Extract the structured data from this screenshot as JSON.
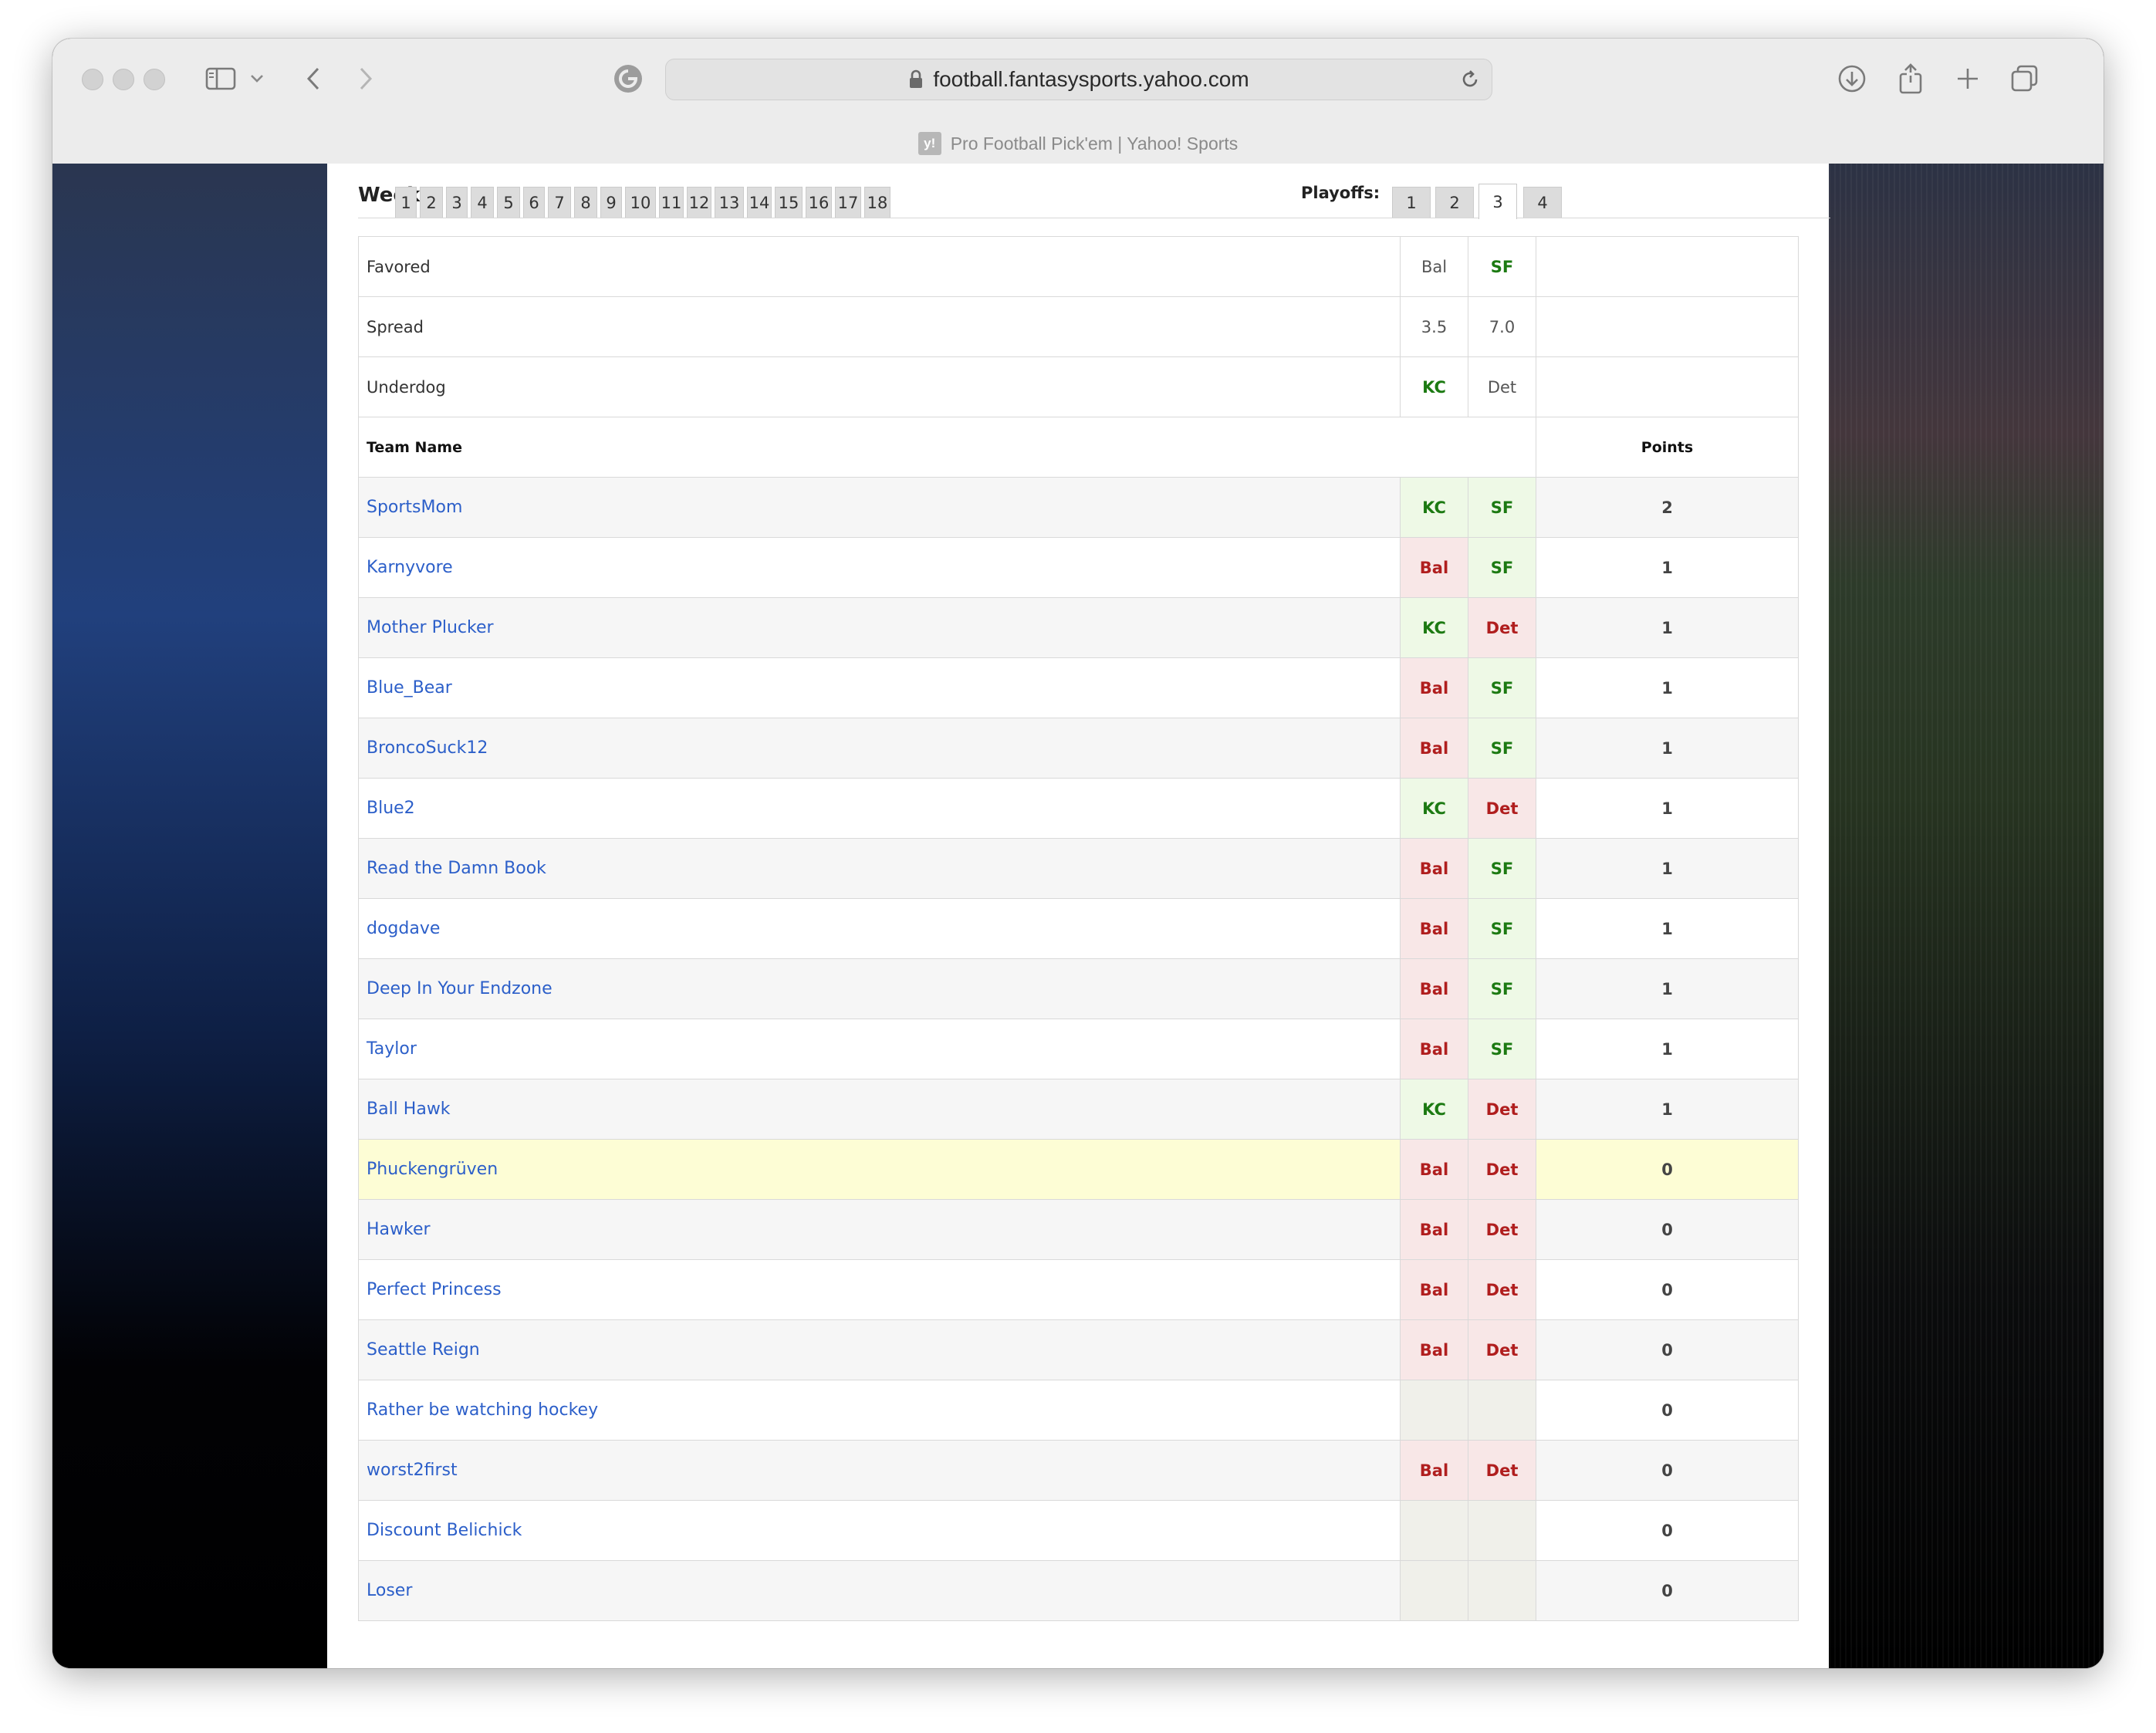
{
  "browser": {
    "url": "football.fantasysports.yahoo.com",
    "tab_title": "Pro Football Pick'em | Yahoo! Sports",
    "favicon_text": "y!"
  },
  "weeks": {
    "label": "Week",
    "items": [
      "1",
      "2",
      "3",
      "4",
      "5",
      "6",
      "7",
      "8",
      "9",
      "10",
      "11",
      "12",
      "13",
      "14",
      "15",
      "16",
      "17",
      "18"
    ],
    "playoffs_label": "Playoffs:",
    "playoffs": [
      "1",
      "2",
      "3",
      "4"
    ],
    "active_playoff": "3"
  },
  "games": {
    "favored_label": "Favored",
    "spread_label": "Spread",
    "underdog_label": "Underdog",
    "game1": {
      "favored": "Bal",
      "spread": "3.5",
      "underdog": "KC",
      "winner": "KC"
    },
    "game2": {
      "favored": "SF",
      "spread": "7.0",
      "underdog": "Det",
      "winner": "SF"
    }
  },
  "table_header": {
    "team_name": "Team Name",
    "points": "Points"
  },
  "teams": [
    {
      "name": "SportsMom",
      "p1": "KC",
      "p2": "SF",
      "points": "2"
    },
    {
      "name": "Karnyvore",
      "p1": "Bal",
      "p2": "SF",
      "points": "1"
    },
    {
      "name": "Mother Plucker",
      "p1": "KC",
      "p2": "Det",
      "points": "1"
    },
    {
      "name": "Blue_Bear",
      "p1": "Bal",
      "p2": "SF",
      "points": "1"
    },
    {
      "name": "BroncoSuck12",
      "p1": "Bal",
      "p2": "SF",
      "points": "1"
    },
    {
      "name": "Blue2",
      "p1": "KC",
      "p2": "Det",
      "points": "1"
    },
    {
      "name": "Read the Damn Book",
      "p1": "Bal",
      "p2": "SF",
      "points": "1"
    },
    {
      "name": "dogdave",
      "p1": "Bal",
      "p2": "SF",
      "points": "1"
    },
    {
      "name": "Deep In Your Endzone",
      "p1": "Bal",
      "p2": "SF",
      "points": "1"
    },
    {
      "name": "Taylor",
      "p1": "Bal",
      "p2": "SF",
      "points": "1"
    },
    {
      "name": "Ball Hawk",
      "p1": "KC",
      "p2": "Det",
      "points": "1"
    },
    {
      "name": "Phuckengrüven",
      "p1": "Bal",
      "p2": "Det",
      "points": "0",
      "highlight": true
    },
    {
      "name": "Hawker",
      "p1": "Bal",
      "p2": "Det",
      "points": "0"
    },
    {
      "name": "Perfect Princess",
      "p1": "Bal",
      "p2": "Det",
      "points": "0"
    },
    {
      "name": "Seattle Reign",
      "p1": "Bal",
      "p2": "Det",
      "points": "0"
    },
    {
      "name": "Rather be watching hockey",
      "p1": "",
      "p2": "",
      "points": "0"
    },
    {
      "name": "worst2first",
      "p1": "Bal",
      "p2": "Det",
      "points": "0"
    },
    {
      "name": "Discount Belichick",
      "p1": "",
      "p2": "",
      "points": "0"
    },
    {
      "name": "Loser",
      "p1": "",
      "p2": "",
      "points": "0"
    }
  ],
  "colors": {
    "correct_pick": "#1c7a12",
    "wrong_pick": "#b01e1e",
    "link": "#2c5fc9",
    "highlight_row": "#fdfdd5"
  }
}
